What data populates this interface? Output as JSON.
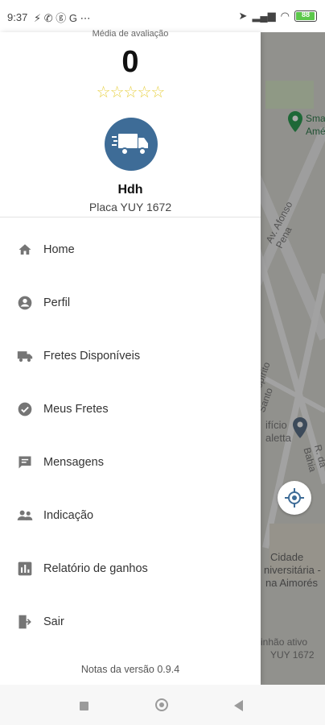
{
  "status_bar": {
    "time": "9:37",
    "notification_glyphs": "⚡ ✆ ⓖ G ⋯",
    "battery": "88"
  },
  "drawer": {
    "rating_label": "Média de avaliação",
    "rating_value": "0",
    "stars": "☆☆☆☆☆",
    "name": "Hdh",
    "plate": "Placa  YUY 1672",
    "menu": [
      {
        "label": "Home",
        "icon": "home-icon"
      },
      {
        "label": "Perfil",
        "icon": "account-circle-icon"
      },
      {
        "label": "Fretes Disponíveis",
        "icon": "truck-icon"
      },
      {
        "label": "Meus Fretes",
        "icon": "check-circle-icon"
      },
      {
        "label": "Mensagens",
        "icon": "message-icon"
      },
      {
        "label": "Indicação",
        "icon": "people-icon"
      },
      {
        "label": "Relatório de ganhos",
        "icon": "bar-chart-icon"
      },
      {
        "label": "Sair",
        "icon": "exit-icon"
      }
    ],
    "version": "Notas da versão 0.9.4"
  },
  "map": {
    "labels": [
      "Sma",
      "Amé",
      "Av. Afonso Pena",
      "Av. Espírito Santo",
      "R. da Bahia",
      "ifício",
      "aletta",
      "Cidade",
      "niversitária -",
      "na Aimorés",
      "inhão ativo",
      "YUY 1672"
    ]
  },
  "colors": {
    "accent": "#3e6c97",
    "star": "#e8d24a",
    "icon": "#757575"
  }
}
